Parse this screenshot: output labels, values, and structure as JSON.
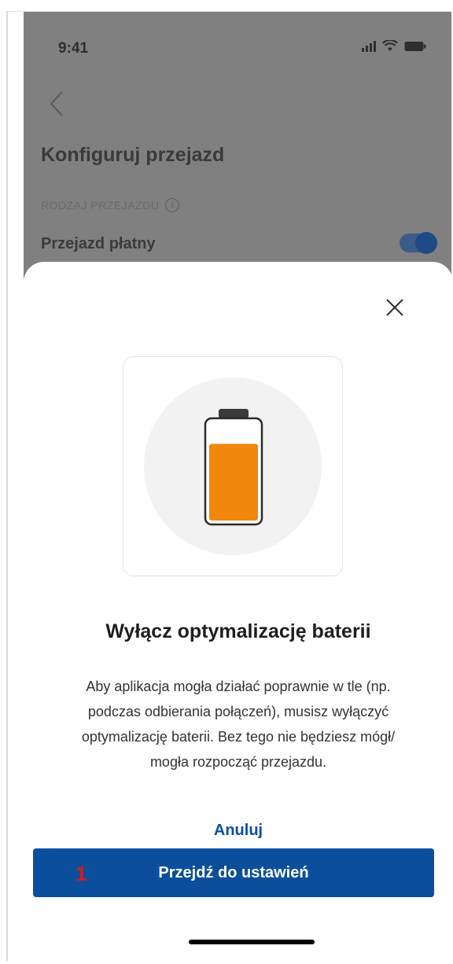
{
  "status_bar": {
    "time": "9:41",
    "icons": [
      "cellular-signal-icon",
      "wifi-icon",
      "battery-icon"
    ]
  },
  "background_screen": {
    "back_icon": "chevron-left-icon",
    "title": "Konfiguruj przejazd",
    "section_label": "RODZAJ PRZEJAZDU",
    "section_info_icon": "info-icon",
    "ride_type_label": "Przejazd płatny",
    "ride_type_toggle_on": true
  },
  "modal": {
    "close_icon": "close-icon",
    "illustration_icon": "battery-illustration",
    "battery_fill_level": 0.78,
    "title": "Wyłącz optymalizację baterii",
    "description_lines": [
      "Aby aplikacja mogła działać poprawnie w tle (np.",
      "podczas odbierania połączeń), musisz wyłączyć",
      "optymalizację baterii. Bez tego nie będziesz mógł/",
      "mogła rozpocząć przejazdu."
    ],
    "cancel_label": "Anuluj",
    "primary_label": "Przejdź do ustawień",
    "step_marker": "1"
  },
  "colors": {
    "primary": "#0b4f9c",
    "battery_fill": "#f0860a",
    "overlay": "#808080",
    "step_marker": "#e0161c"
  }
}
